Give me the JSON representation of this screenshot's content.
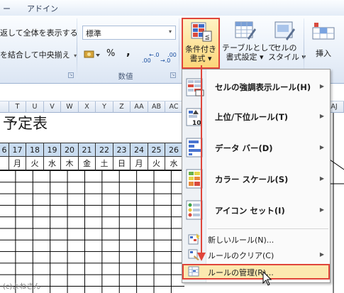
{
  "tabs": {
    "partial": "ー",
    "addin": "アドイン"
  },
  "alignment": {
    "shrink_to_fit": "返して全体を表示する",
    "merge_center": "を結合して中央揃え"
  },
  "number": {
    "format_value": "標準",
    "percent": "%",
    "comma": ",",
    "inc_decimal": "←.0\n.00",
    "dec_decimal": ".00\n→.0",
    "group_label": "数値"
  },
  "styles": {
    "cond_format": "条件付き\n書式 ▾",
    "table_format": "テーブルとして\n書式設定 ▾",
    "cell_styles": "セルの\nスタイル ▾"
  },
  "cells": {
    "insert": "挿入"
  },
  "columns": [
    "",
    "T",
    "U",
    "V",
    "W",
    "X",
    "Y",
    "Z",
    "AA",
    "AB",
    "AC"
  ],
  "columns_right": [
    "AJ"
  ],
  "sheet_title": "予定表",
  "day_numbers": [
    "6",
    "17",
    "18",
    "19",
    "20",
    "21",
    "22",
    "23",
    "24",
    "25",
    "26"
  ],
  "weekdays": [
    "",
    "月",
    "火",
    "水",
    "木",
    "金",
    "土",
    "日",
    "月",
    "火",
    "水"
  ],
  "watermark": "(c)よねさん",
  "menu": {
    "items": [
      {
        "label": "セルの強調表示ルール(H)",
        "icon": "highlight-rules-icon",
        "submenu": true
      },
      {
        "label": "上位/下位ルール(T)",
        "icon": "top-bottom-rules-icon",
        "submenu": true
      },
      {
        "label": "データ バー(D)",
        "icon": "data-bars-icon",
        "submenu": true
      },
      {
        "label": "カラー スケール(S)",
        "icon": "color-scales-icon",
        "submenu": true
      },
      {
        "label": "アイコン セット(I)",
        "icon": "icon-sets-icon",
        "submenu": true
      }
    ],
    "small_items": [
      {
        "label": "新しいルール(N)...",
        "icon": "new-rule-icon"
      },
      {
        "label": "ルールのクリア(C)",
        "icon": "clear-rules-icon",
        "submenu": true
      },
      {
        "label": "ルールの管理(R)...",
        "icon": "manage-rules-icon"
      }
    ]
  },
  "colors": {
    "highlight_border": "#e0453a",
    "hover_fill": "#fce9b0",
    "day_header_bg": "#c9dcf0"
  }
}
